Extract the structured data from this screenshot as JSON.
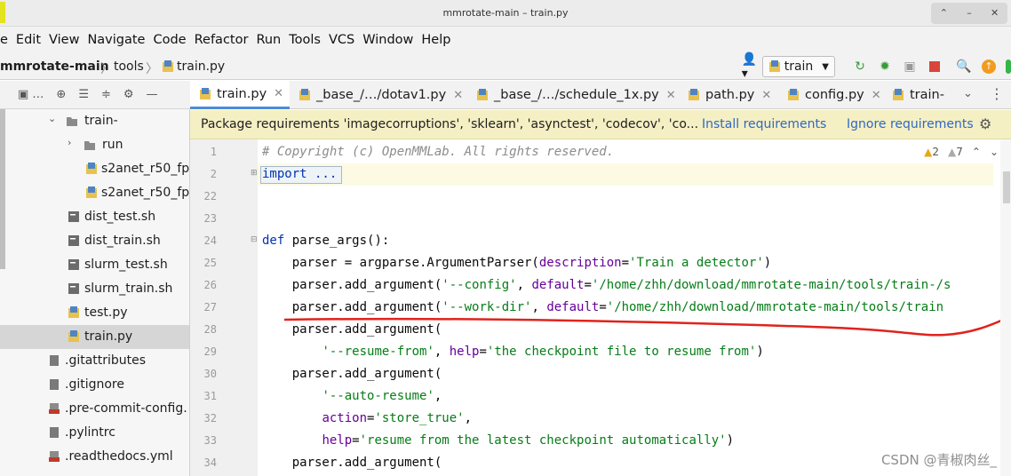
{
  "window": {
    "title": "mmrotate-main – train.py"
  },
  "menu": [
    "e",
    "Edit",
    "View",
    "Navigate",
    "Code",
    "Refactor",
    "Run",
    "Tools",
    "VCS",
    "Window",
    "Help"
  ],
  "breadcrumb": [
    "mmrotate-main",
    "tools",
    "train.py"
  ],
  "run_config": "train",
  "tree": [
    {
      "label": "train-",
      "type": "folder",
      "expanded": true
    },
    {
      "label": "run",
      "type": "folder",
      "expanded": false
    },
    {
      "label": "s2anet_r50_fp",
      "type": "pyfile"
    },
    {
      "label": "s2anet_r50_fp",
      "type": "pyfile"
    },
    {
      "label": "dist_test.sh",
      "type": "sh"
    },
    {
      "label": "dist_train.sh",
      "type": "sh"
    },
    {
      "label": "slurm_test.sh",
      "type": "sh"
    },
    {
      "label": "slurm_train.sh",
      "type": "sh"
    },
    {
      "label": "test.py",
      "type": "py"
    },
    {
      "label": "train.py",
      "type": "py",
      "selected": true
    },
    {
      "label": ".gitattributes",
      "type": "file"
    },
    {
      "label": ".gitignore",
      "type": "file"
    },
    {
      "label": ".pre-commit-config.",
      "type": "yml"
    },
    {
      "label": ".pylintrc",
      "type": "file"
    },
    {
      "label": ".readthedocs.yml",
      "type": "yml"
    }
  ],
  "tabs": [
    {
      "label": "train.py",
      "active": true
    },
    {
      "label": "_base_/…/dotav1.py"
    },
    {
      "label": "_base_/…/schedule_1x.py"
    },
    {
      "label": "path.py"
    },
    {
      "label": "config.py"
    },
    {
      "label": "train-"
    }
  ],
  "notice": {
    "text": "Package requirements 'imagecorruptions', 'sklearn', 'asynctest', 'codecov', 'co...",
    "install": "Install requirements",
    "ignore": "Ignore requirements"
  },
  "inspections": {
    "warnings": "2",
    "weak": "7"
  },
  "line_numbers": [
    "1",
    "2",
    "22",
    "23",
    "24",
    "25",
    "26",
    "27",
    "28",
    "29",
    "30",
    "31",
    "32",
    "33",
    "34"
  ],
  "code": {
    "l1": "# Copyright (c) OpenMMLab. All rights reserved.",
    "l2": "import ...",
    "def": "def",
    "fn": " parse_args():",
    "l25a": "    parser = argparse.ArgumentParser(",
    "l25p": "description",
    "l25s": "'Train a detector'",
    "l26a": "    parser.add_argument(",
    "l26s": "'--config'",
    "l26p": "default",
    "l26v": "'/home/zhh/download/mmrotate-main/tools/train-/s",
    "l27a": "    parser.add_argument(",
    "l27s": "'--work-dir'",
    "l27p": "default",
    "l27v": "'/home/zhh/download/mmrotate-main/tools/train",
    "l28": "    parser.add_argument(",
    "l29s": "'--resume-from'",
    "l29p": "help",
    "l29v": "'the checkpoint file to resume from'",
    "l30": "    parser.add_argument(",
    "l31s": "'--auto-resume'",
    "l32p": "action",
    "l32v": "'store_true'",
    "l33p": "help",
    "l33v": "'resume from the latest checkpoint automatically'",
    "l34": "    parser.add_argument("
  },
  "watermark": "CSDN @青椒肉丝_"
}
